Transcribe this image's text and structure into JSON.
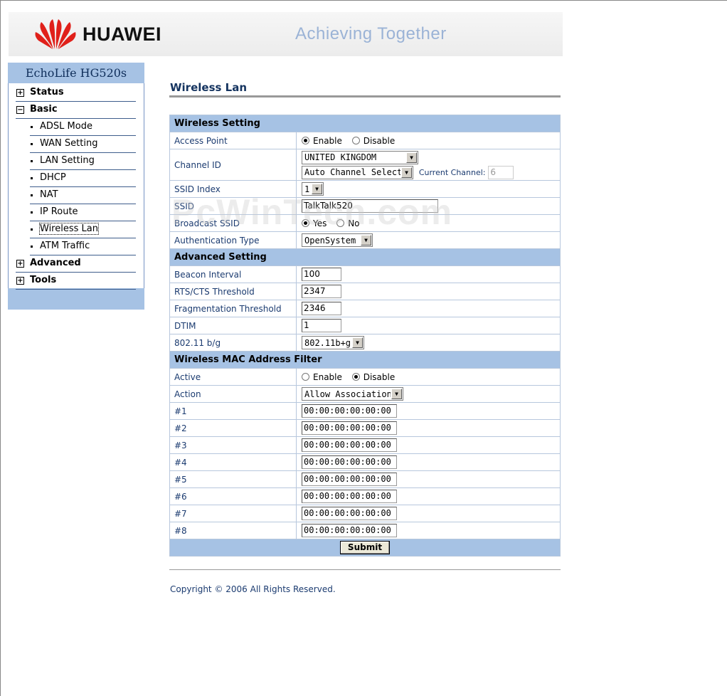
{
  "header": {
    "brand": "HUAWEI",
    "slogan": "Achieving Together"
  },
  "sidebar": {
    "title": "EchoLife HG520s",
    "items": [
      {
        "label": "Status",
        "expander": "+"
      },
      {
        "label": "Basic",
        "expander": "−"
      },
      {
        "label": "ADSL Mode"
      },
      {
        "label": "WAN Setting"
      },
      {
        "label": "LAN Setting"
      },
      {
        "label": "DHCP"
      },
      {
        "label": "NAT"
      },
      {
        "label": "IP Route"
      },
      {
        "label": "Wireless Lan"
      },
      {
        "label": "ATM Traffic"
      },
      {
        "label": "Advanced",
        "expander": "+"
      },
      {
        "label": "Tools",
        "expander": "+"
      }
    ]
  },
  "page": {
    "title": "Wireless Lan",
    "copyright": "Copyright © 2006 All Rights Reserved."
  },
  "wireless_setting": {
    "section": "Wireless Setting",
    "access_point": {
      "label": "Access Point",
      "enable": "Enable",
      "disable": "Disable",
      "selected": "Enable"
    },
    "channel_id": {
      "label": "Channel ID",
      "region": "UNITED KINGDOM",
      "channel": "Auto Channel Select",
      "current_label": "Current Channel:",
      "current_value": "6"
    },
    "ssid_index": {
      "label": "SSID Index",
      "value": "1"
    },
    "ssid": {
      "label": "SSID",
      "value": "TalkTalk520"
    },
    "broadcast_ssid": {
      "label": "Broadcast SSID",
      "yes": "Yes",
      "no": "No",
      "selected": "Yes"
    },
    "auth_type": {
      "label": "Authentication Type",
      "value": "OpenSystem"
    }
  },
  "advanced_setting": {
    "section": "Advanced Setting",
    "beacon": {
      "label": "Beacon Interval",
      "value": "100"
    },
    "rts": {
      "label": "RTS/CTS Threshold",
      "value": "2347"
    },
    "frag": {
      "label": "Fragmentation Threshold",
      "value": "2346"
    },
    "dtim": {
      "label": "DTIM",
      "value": "1"
    },
    "mode": {
      "label": "802.11 b/g",
      "value": "802.11b+g"
    }
  },
  "mac_filter": {
    "section": "Wireless MAC Address Filter",
    "active": {
      "label": "Active",
      "enable": "Enable",
      "disable": "Disable",
      "selected": "Disable"
    },
    "action": {
      "label": "Action",
      "value": "Allow Association"
    },
    "entries": [
      {
        "label": "#1",
        "value": "00:00:00:00:00:00"
      },
      {
        "label": "#2",
        "value": "00:00:00:00:00:00"
      },
      {
        "label": "#3",
        "value": "00:00:00:00:00:00"
      },
      {
        "label": "#4",
        "value": "00:00:00:00:00:00"
      },
      {
        "label": "#5",
        "value": "00:00:00:00:00:00"
      },
      {
        "label": "#6",
        "value": "00:00:00:00:00:00"
      },
      {
        "label": "#7",
        "value": "00:00:00:00:00:00"
      },
      {
        "label": "#8",
        "value": "00:00:00:00:00:00"
      }
    ]
  },
  "submit_label": "Submit",
  "watermark": "PcWinTech.com",
  "colors": {
    "accent": "#a6c2e4",
    "title": "#14335f",
    "logo_red": "#e0201a"
  }
}
